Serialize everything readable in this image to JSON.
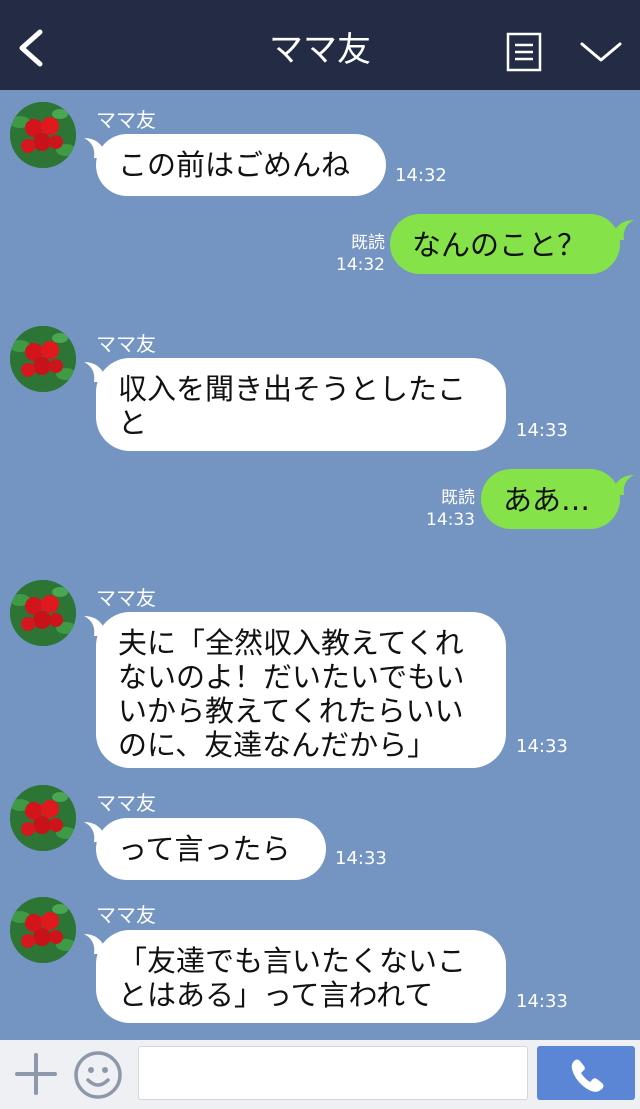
{
  "header": {
    "title": "ママ友"
  },
  "colors": {
    "header_bg": "#232c44",
    "chat_bg": "#7494c2",
    "outgoing": "#85e249",
    "incoming": "#ffffff",
    "send_button": "#5b86d6"
  },
  "messages": [
    {
      "sender": "ママ友",
      "text": "この前はごめんね",
      "time": "14:32",
      "direction": "incoming"
    },
    {
      "text": "なんのこと？",
      "time": "14:32",
      "read": "既読",
      "direction": "outgoing"
    },
    {
      "sender": "ママ友",
      "text": "収入を聞き出そうとしたこ\nと",
      "time": "14:33",
      "direction": "incoming"
    },
    {
      "text": "ああ…",
      "time": "14:33",
      "read": "既読",
      "direction": "outgoing"
    },
    {
      "sender": "ママ友",
      "text": "夫に「全然収入教えてくれ\nないのよ！だいたいでもい\nいから教えてくれたらいい\nのに、友達なんだから」",
      "time": "14:33",
      "direction": "incoming"
    },
    {
      "sender": "ママ友",
      "text": "って言ったら",
      "time": "14:33",
      "direction": "incoming"
    },
    {
      "sender": "ママ友",
      "text": "「友達でも言いたくないこ\nとはある」って言われて",
      "time": "14:33",
      "direction": "incoming"
    }
  ],
  "icons": {
    "back": "chevron-left-icon",
    "menu": "list-icon",
    "collapse": "chevron-down-icon",
    "add": "plus-icon",
    "emoji": "smiley-icon",
    "call": "phone-icon"
  },
  "footer": {
    "input_value": ""
  }
}
